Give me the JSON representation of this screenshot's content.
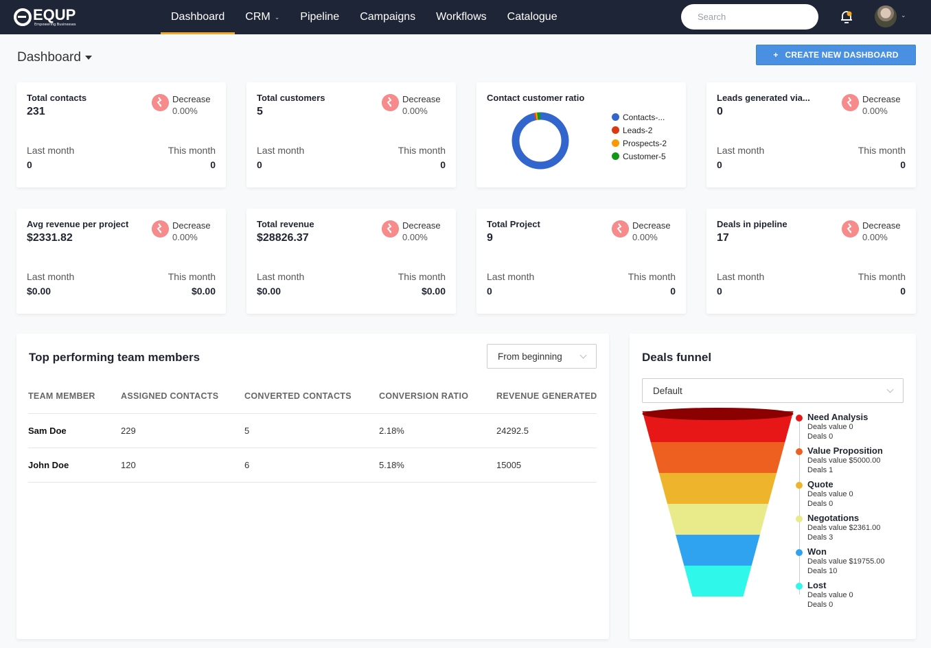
{
  "brand": {
    "name": "EQUP",
    "tagline": "Empowering Businesses"
  },
  "nav": {
    "items": [
      {
        "label": "Dashboard",
        "active": true,
        "has_dropdown": false
      },
      {
        "label": "CRM",
        "active": false,
        "has_dropdown": true
      },
      {
        "label": "Pipeline",
        "active": false,
        "has_dropdown": false
      },
      {
        "label": "Campaigns",
        "active": false,
        "has_dropdown": false
      },
      {
        "label": "Workflows",
        "active": false,
        "has_dropdown": false
      },
      {
        "label": "Catalogue",
        "active": false,
        "has_dropdown": false
      }
    ],
    "search_placeholder": "Search",
    "accent": "#f6a623",
    "bg": "#1e2537"
  },
  "header": {
    "title": "Dashboard",
    "create_button": "CREATE NEW DASHBOARD",
    "create_icon": "+"
  },
  "stats": [
    {
      "title": "Total contacts",
      "value": "231",
      "trend": "Decrease",
      "pct": "0.00%",
      "last_month_label": "Last month",
      "last_month": "0",
      "this_month_label": "This month",
      "this_month": "0"
    },
    {
      "title": "Total customers",
      "value": "5",
      "trend": "Decrease",
      "pct": "0.00%",
      "last_month_label": "Last month",
      "last_month": "0",
      "this_month_label": "This month",
      "this_month": "0"
    },
    {
      "title": "Leads generated via...",
      "value": "0",
      "trend": "Decrease",
      "pct": "0.00%",
      "last_month_label": "Last month",
      "last_month": "0",
      "this_month_label": "This month",
      "this_month": "0"
    },
    {
      "title": "Avg revenue per project",
      "value": "$2331.82",
      "trend": "Decrease",
      "pct": "0.00%",
      "last_month_label": "Last month",
      "last_month": "$0.00",
      "this_month_label": "This month",
      "this_month": "$0.00"
    },
    {
      "title": "Total revenue",
      "value": "$28826.37",
      "trend": "Decrease",
      "pct": "0.00%",
      "last_month_label": "Last month",
      "last_month": "$0.00",
      "this_month_label": "This month",
      "this_month": "$0.00"
    },
    {
      "title": "Total Project",
      "value": "9",
      "trend": "Decrease",
      "pct": "0.00%",
      "last_month_label": "Last month",
      "last_month": "0",
      "this_month_label": "This month",
      "this_month": "0"
    },
    {
      "title": "Deals in pipeline",
      "value": "17",
      "trend": "Decrease",
      "pct": "0.00%",
      "last_month_label": "Last month",
      "last_month": "0",
      "this_month_label": "This month",
      "this_month": "0"
    }
  ],
  "ratio": {
    "title": "Contact customer ratio",
    "segments": [
      {
        "label": "Contacts-...",
        "value": 231,
        "color": "#3366cc"
      },
      {
        "label": "Leads-2",
        "value": 2,
        "color": "#dc3912"
      },
      {
        "label": "Prospects-2",
        "value": 2,
        "color": "#ff9900"
      },
      {
        "label": "Customer-5",
        "value": 5,
        "color": "#109618"
      }
    ]
  },
  "team": {
    "title": "Top performing team members",
    "period": "From beginning",
    "columns": [
      "TEAM MEMBER",
      "ASSIGNED CONTACTS",
      "CONVERTED CONTACTS",
      "CONVERSION RATIO",
      "REVENUE GENERATED"
    ],
    "rows": [
      [
        "Sam Doe",
        "229",
        "5",
        "2.18%",
        "24292.5"
      ],
      [
        "John Doe",
        "120",
        "6",
        "5.18%",
        "15005"
      ]
    ]
  },
  "funnel": {
    "title": "Deals funnel",
    "selected": "Default",
    "stages": [
      {
        "name": "Need Analysis",
        "value_text": "Deals value 0",
        "count_text": "Deals 0",
        "color": "#e81717"
      },
      {
        "name": "Value Proposition",
        "value_text": "Deals value $5000.00",
        "count_text": "Deals 1",
        "color": "#ee6020"
      },
      {
        "name": "Quote",
        "value_text": "Deals value 0",
        "count_text": "Deals 0",
        "color": "#eeb52c"
      },
      {
        "name": "Negotations",
        "value_text": "Deals value $2361.00",
        "count_text": "Deals 3",
        "color": "#e9ea8a"
      },
      {
        "name": "Won",
        "value_text": "Deals value $19755.00",
        "count_text": "Deals 10",
        "color": "#2fa3ef"
      },
      {
        "name": "Lost",
        "value_text": "Deals value 0",
        "count_text": "Deals 0",
        "color": "#2ff7ea"
      }
    ],
    "rim_color": "#8b0000"
  }
}
